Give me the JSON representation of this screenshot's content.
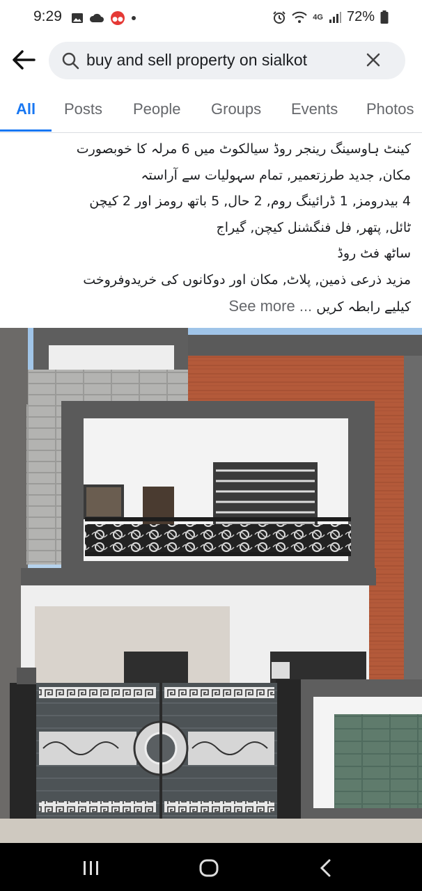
{
  "status_bar": {
    "time": "9:29",
    "network": "4G",
    "battery": "72%",
    "icons": [
      "gallery-icon",
      "cloud-icon",
      "app-notification-icon",
      "dot-icon",
      "alarm-icon",
      "wifi-icon",
      "signal-icon",
      "battery-icon"
    ]
  },
  "search": {
    "query": "buy and sell property on sialkot",
    "back_icon": "arrow-left-icon",
    "search_icon": "magnifier-icon",
    "clear_icon": "close-icon"
  },
  "tabs": [
    {
      "label": "All",
      "active": true
    },
    {
      "label": "Posts",
      "active": false
    },
    {
      "label": "People",
      "active": false
    },
    {
      "label": "Groups",
      "active": false
    },
    {
      "label": "Events",
      "active": false
    },
    {
      "label": "Photos",
      "active": false
    }
  ],
  "post": {
    "lines": [
      "کینٹ ہاوسینگ رینجر روڈ سیالکوٹ میں 6 مرلہ کا خوبصورت",
      "مکان, جدید طرزتعمیر, تمام سہولیات سے آراستہ",
      "4 بیدرومز, 1 ڈرائینگ روم, 2 حال, 5 باتھ رومز اور 2 کیچن",
      "ٹائل, پتھر, فل فنگشنل کیچن, گیراج",
      "ساٹھ فٹ روڈ",
      "مزید ذرعی ذمین, پلاٹ, مکان اور دوکانوں کی خریدوفروخت"
    ],
    "last_line": "کیلیے رابطہ کریں",
    "see_more": "See more ...",
    "image_description_icon": "house-photo"
  },
  "nav": {
    "recent_icon": "recent-apps-icon",
    "home_icon": "home-icon",
    "back_icon": "back-chevron-icon"
  },
  "colors": {
    "accent": "#1877f2",
    "search_bg": "#eef0f3",
    "tab_inactive": "#65676b"
  }
}
